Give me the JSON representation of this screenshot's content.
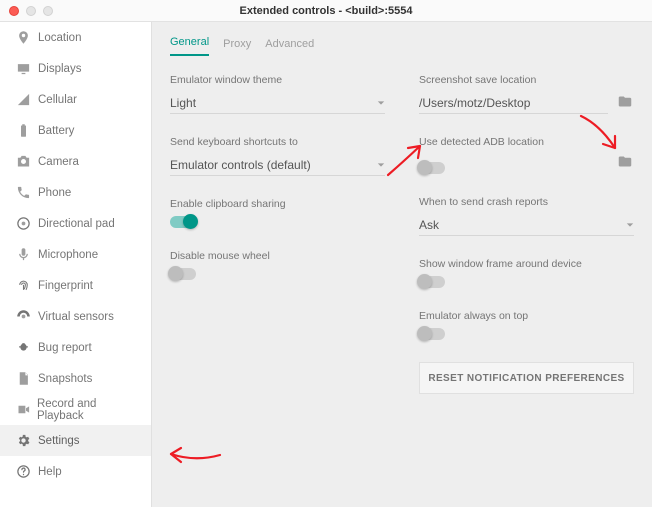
{
  "window": {
    "title": "Extended controls - <build>:5554"
  },
  "sidebar": {
    "items": [
      {
        "label": "Location",
        "icon": "location-icon"
      },
      {
        "label": "Displays",
        "icon": "displays-icon"
      },
      {
        "label": "Cellular",
        "icon": "cellular-icon"
      },
      {
        "label": "Battery",
        "icon": "battery-icon"
      },
      {
        "label": "Camera",
        "icon": "camera-icon"
      },
      {
        "label": "Phone",
        "icon": "phone-icon"
      },
      {
        "label": "Directional pad",
        "icon": "dpad-icon"
      },
      {
        "label": "Microphone",
        "icon": "microphone-icon"
      },
      {
        "label": "Fingerprint",
        "icon": "fingerprint-icon"
      },
      {
        "label": "Virtual sensors",
        "icon": "sensors-icon"
      },
      {
        "label": "Bug report",
        "icon": "bug-icon"
      },
      {
        "label": "Snapshots",
        "icon": "snapshots-icon"
      },
      {
        "label": "Record and Playback",
        "icon": "record-icon"
      },
      {
        "label": "Settings",
        "icon": "settings-icon",
        "selected": true
      },
      {
        "label": "Help",
        "icon": "help-icon"
      }
    ]
  },
  "tabs": [
    {
      "label": "General",
      "active": true
    },
    {
      "label": "Proxy"
    },
    {
      "label": "Advanced"
    }
  ],
  "settings": {
    "left": {
      "theme": {
        "label": "Emulator window theme",
        "value": "Light"
      },
      "shortcuts": {
        "label": "Send keyboard shortcuts to",
        "value": "Emulator controls (default)"
      },
      "clipboard": {
        "label": "Enable clipboard sharing",
        "on": true
      },
      "mouse_wheel": {
        "label": "Disable mouse wheel",
        "on": false
      }
    },
    "right": {
      "screenshot": {
        "label": "Screenshot save location",
        "value": "/Users/motz/Desktop"
      },
      "adb": {
        "label": "Use detected ADB location",
        "on": false
      },
      "crash": {
        "label": "When to send crash reports",
        "value": "Ask"
      },
      "window_frame": {
        "label": "Show window frame around device",
        "on": false
      },
      "always_top": {
        "label": "Emulator always on top",
        "on": false
      },
      "reset_btn": "RESET NOTIFICATION PREFERENCES"
    }
  },
  "colors": {
    "accent": "#009688",
    "arrow": "#ed1c24"
  }
}
